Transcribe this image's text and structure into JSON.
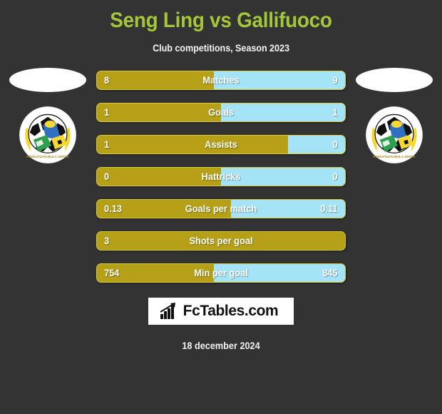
{
  "header": {
    "title": "Seng Ling vs Gallifuoco",
    "subtitle": "Club competitions, Season 2023"
  },
  "colors": {
    "background": "#333333",
    "title_green": "#a4c639",
    "home_gold": "#b5a018",
    "away_cyan": "#a5e4f7",
    "bar_border": "#d8c93c",
    "text_white": "#ffffff"
  },
  "crests": {
    "left": {
      "name": "club-crest-left"
    },
    "right": {
      "name": "club-crest-right"
    }
  },
  "chart_data": {
    "type": "bar",
    "title": "Seng Ling vs Gallifuoco",
    "subtitle": "Club competitions, Season 2023",
    "orientation": "horizontal-diverging",
    "series": [
      {
        "name": "Seng Ling",
        "color": "#b5a018"
      },
      {
        "name": "Gallifuoco",
        "color": "#a5e4f7"
      }
    ],
    "categories": [
      "Matches",
      "Goals",
      "Assists",
      "Hattricks",
      "Goals per match",
      "Shots per goal",
      "Min per goal"
    ],
    "rows": [
      {
        "label": "Matches",
        "left": "8",
        "right": "9",
        "left_pct": 47
      },
      {
        "label": "Goals",
        "left": "1",
        "right": "1",
        "left_pct": 50
      },
      {
        "label": "Assists",
        "left": "1",
        "right": "0",
        "left_pct": 77
      },
      {
        "label": "Hattricks",
        "left": "0",
        "right": "0",
        "left_pct": 50
      },
      {
        "label": "Goals per match",
        "left": "0.13",
        "right": "0.11",
        "left_pct": 54
      },
      {
        "label": "Shots per goal",
        "left": "3",
        "right": "",
        "left_pct": 100
      },
      {
        "label": "Min per goal",
        "left": "754",
        "right": "845",
        "left_pct": 47
      }
    ]
  },
  "footer": {
    "logo_text": "FcTables.com",
    "date": "18 december 2024"
  }
}
